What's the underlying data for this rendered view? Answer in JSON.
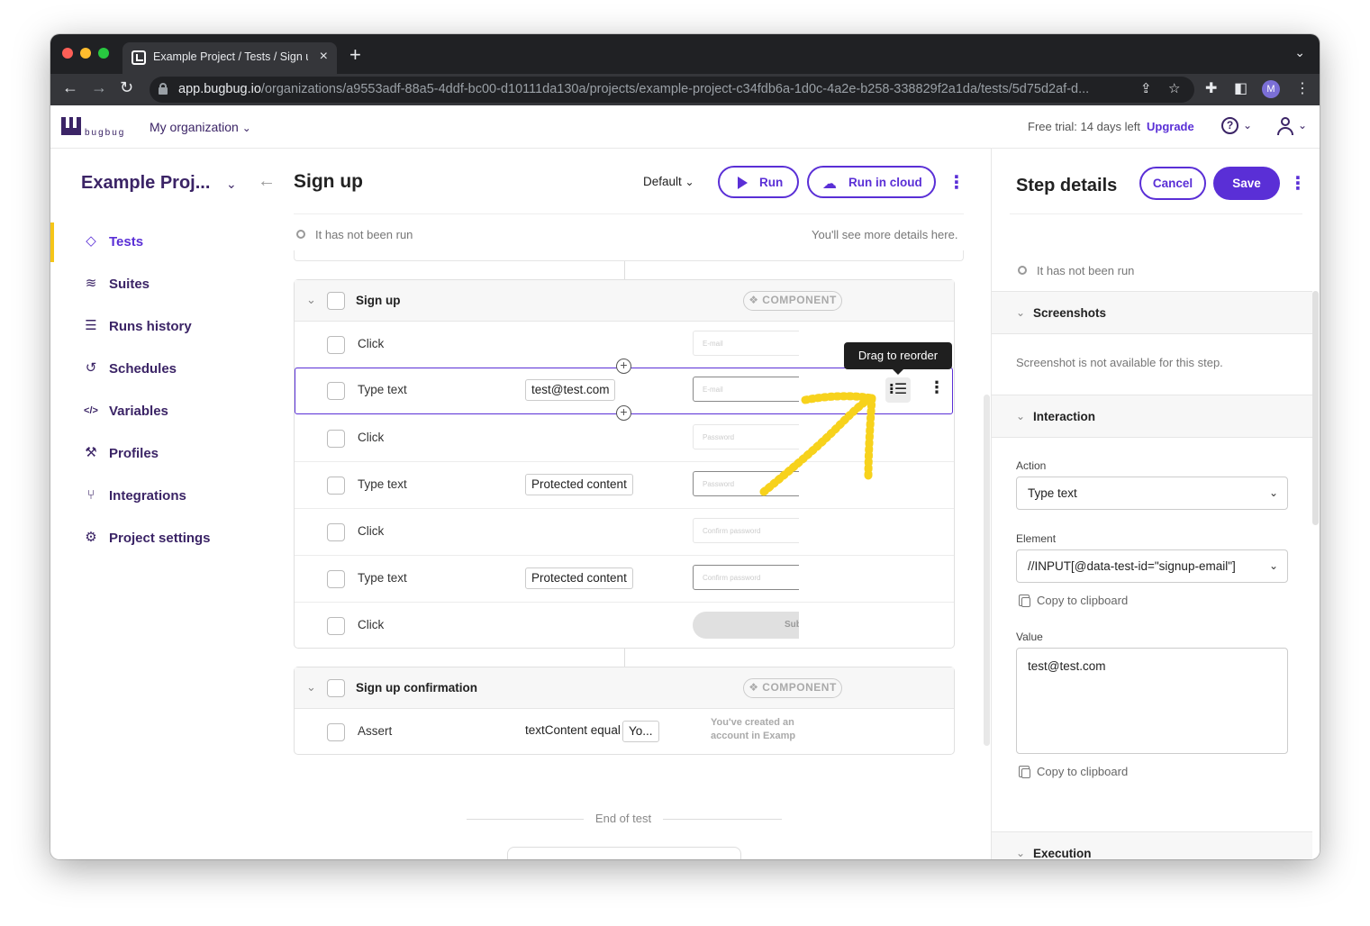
{
  "browser": {
    "tab_title": "Example Project / Tests / Sign up",
    "url_host": "app.bugbug.io",
    "url_path": "/organizations/a9553adf-88a5-4ddf-bc00-d10111da130a/projects/example-project-c34fdb6a-1d0c-4a2e-b258-338829f2a1da/tests/5d75d2af-d...",
    "profile_initial": "M"
  },
  "header": {
    "logo_text": "bugbug",
    "organization": "My organization",
    "trial_text": "Free trial: 14 days left",
    "upgrade_label": "Upgrade"
  },
  "sidebar": {
    "project_name": "Example Proj...",
    "items": [
      {
        "label": "Tests",
        "icon": "diamond-icon",
        "active": true
      },
      {
        "label": "Suites",
        "icon": "layers-icon"
      },
      {
        "label": "Runs history",
        "icon": "list-icon"
      },
      {
        "label": "Schedules",
        "icon": "history-icon"
      },
      {
        "label": "Variables",
        "icon": "code-icon"
      },
      {
        "label": "Profiles",
        "icon": "wrench-icon"
      },
      {
        "label": "Integrations",
        "icon": "integration-icon"
      },
      {
        "label": "Project settings",
        "icon": "gear-icon"
      }
    ]
  },
  "main": {
    "test_title": "Sign up",
    "profile_select": "Default",
    "run_label": "Run",
    "run_cloud_label": "Run in cloud",
    "status": "It has not been run",
    "status_hint": "You'll see more details here.",
    "tooltip": "Drag to reorder",
    "end_of_test": "End of test",
    "components": [
      {
        "title": "Sign up",
        "badge": "❖ COMPONENT",
        "steps": [
          {
            "label": "Click",
            "value": "",
            "thumb": "E-mail"
          },
          {
            "label": "Type text",
            "value": "test@test.com",
            "thumb": "E-mail"
          },
          {
            "label": "Click",
            "value": "",
            "thumb": "Password"
          },
          {
            "label": "Type text",
            "value": "Protected content",
            "thumb": "Password"
          },
          {
            "label": "Click",
            "value": "",
            "thumb": "Confirm password"
          },
          {
            "label": "Type text",
            "value": "Protected content",
            "thumb": "Confirm password"
          },
          {
            "label": "Click",
            "value": "",
            "thumb": "Sub"
          }
        ]
      },
      {
        "title": "Sign up confirmation",
        "badge": "❖ COMPONENT",
        "steps": [
          {
            "label": "Assert",
            "assert_type": "textContent equal",
            "value": "Yo...",
            "thumb_line1": "You've created an",
            "thumb_line2": "account in Examp"
          }
        ]
      }
    ]
  },
  "step_details": {
    "title": "Step details",
    "cancel_label": "Cancel",
    "save_label": "Save",
    "status": "It has not been run",
    "sections": {
      "screenshots": "Screenshots",
      "interaction": "Interaction",
      "execution": "Execution"
    },
    "screenshot_note": "Screenshot is not available for this step.",
    "action_label": "Action",
    "action_value": "Type text",
    "element_label": "Element",
    "element_value": "//INPUT[@data-test-id=\"signup-email\"]",
    "copy_label": "Copy to clipboard",
    "value_label": "Value",
    "value_value": "test@test.com"
  },
  "colors": {
    "accent": "#5a2fd6",
    "brand_dark": "#3b2466",
    "active_marker": "#f5c518",
    "annotation": "#f7d21c"
  }
}
